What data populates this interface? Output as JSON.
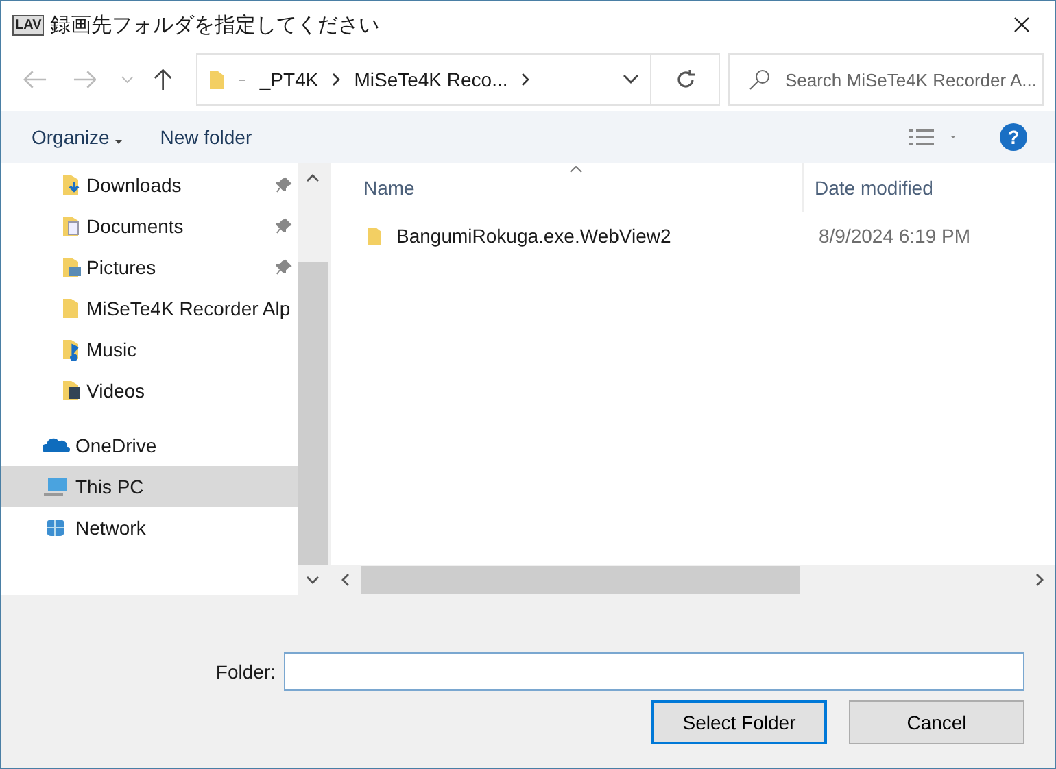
{
  "window": {
    "title": "録画先フォルダを指定してください",
    "app_icon": "LAV"
  },
  "address": {
    "crumbs": [
      "_PT4K",
      "MiSeTe4K Reco..."
    ],
    "search_placeholder": "Search MiSeTe4K Recorder A..."
  },
  "toolbar": {
    "organize": "Organize",
    "new_folder": "New folder",
    "help": "?"
  },
  "nav": {
    "quick_access_children": [
      {
        "label": "Downloads",
        "kind": "downloads",
        "pinned": true,
        "selected": false
      },
      {
        "label": "Documents",
        "kind": "documents",
        "pinned": true,
        "selected": false
      },
      {
        "label": "Pictures",
        "kind": "pictures",
        "pinned": true,
        "selected": false
      },
      {
        "label": "MiSeTe4K Recorder Alp",
        "kind": "folder",
        "pinned": false,
        "selected": false
      },
      {
        "label": "Music",
        "kind": "music",
        "pinned": false,
        "selected": false
      },
      {
        "label": "Videos",
        "kind": "videos",
        "pinned": false,
        "selected": false
      }
    ],
    "roots": [
      {
        "label": "OneDrive",
        "kind": "cloud",
        "selected": false
      },
      {
        "label": "This PC",
        "kind": "pc",
        "selected": true
      },
      {
        "label": "Network",
        "kind": "network",
        "selected": false
      }
    ]
  },
  "table": {
    "columns": [
      "Name",
      "Date modified"
    ],
    "rows": [
      {
        "name": "BangumiRokuga.exe.WebView2",
        "date": "8/9/2024 6:19 PM",
        "selected": false
      }
    ]
  },
  "footer": {
    "folder_label": "Folder:",
    "buttons": [
      "Select Folder",
      "Cancel"
    ]
  }
}
